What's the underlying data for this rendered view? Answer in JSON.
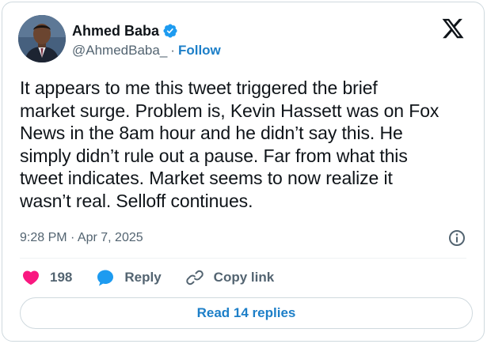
{
  "author": {
    "display_name": "Ahmed Baba",
    "handle": "@AhmedBaba_",
    "separator": "·",
    "follow_label": "Follow",
    "verified": true
  },
  "tweet": {
    "text": "It appears to me this tweet triggered the brief\nmarket surge. Problem is, Kevin Hassett was on Fox\nNews in the 8am hour and he didn’t say this. He\nsimply didn’t rule out a pause. Far from what this\ntweet indicates. Market seems to now realize it\nwasn’t real. Selloff continues.",
    "timestamp": "9:28 PM · Apr 7, 2025"
  },
  "actions": {
    "like_count": "198",
    "reply_label": "Reply",
    "copy_link_label": "Copy link"
  },
  "footer": {
    "read_replies_label": "Read 14 replies"
  },
  "icons": {
    "brand": "x-logo",
    "verified": "verified-badge-icon",
    "info": "info-icon",
    "like": "heart-icon",
    "reply": "speech-bubble-icon",
    "copy_link": "link-icon"
  },
  "colors": {
    "accent": "#1d7fc8",
    "verified": "#1d9bf0",
    "like": "#f91880",
    "text": "#0f1419",
    "secondary": "#536471",
    "border": "#cfd9de"
  }
}
